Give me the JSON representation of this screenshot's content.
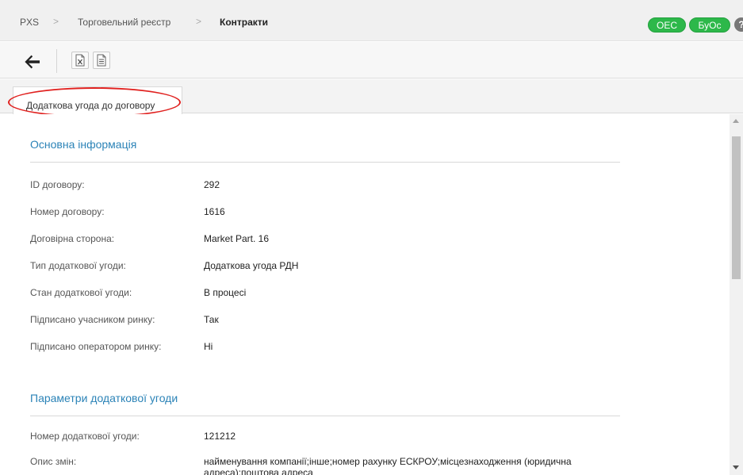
{
  "breadcrumb": {
    "root": "PXS",
    "middle": "Торговельний реєстр",
    "current": "Контракти",
    "separator": ">"
  },
  "badges": {
    "oes": "ОЕС",
    "byos": "БуОс"
  },
  "help": "?",
  "toolbar": {
    "back_icon": "back-arrow-icon",
    "excel_icon": "excel-export-icon",
    "doc_icon": "document-icon"
  },
  "tabs": [
    {
      "label": "Додаткова угода до договору",
      "active": true
    }
  ],
  "sections": {
    "main_info": {
      "title": "Основна інформація",
      "rows": [
        {
          "label": "ID договору:",
          "value": "292"
        },
        {
          "label": "Номер договору:",
          "value": "1616"
        },
        {
          "label": "Договірна сторона:",
          "value": "Market Part. 16"
        },
        {
          "label": "Тип додаткової угоди:",
          "value": "Додаткова угода РДН"
        },
        {
          "label": "Стан додаткової угоди:",
          "value": "В процесі"
        },
        {
          "label": "Підписано учасником ринку:",
          "value": "Так"
        },
        {
          "label": "Підписано оператором ринку:",
          "value": "Ні"
        }
      ]
    },
    "params": {
      "title": "Параметри додаткової угоди",
      "rows": [
        {
          "label": "Номер додаткової угоди:",
          "value": "121212"
        },
        {
          "label": "Опис змін:",
          "value": "найменування компанії;інше;номер рахунку ЕСКРОУ;місцезнаходження (юридична адреса);поштова адреса"
        }
      ]
    }
  },
  "colors": {
    "accent": "#2b83b7",
    "badge_green": "#2db84a",
    "highlight_red": "#e0211f"
  }
}
